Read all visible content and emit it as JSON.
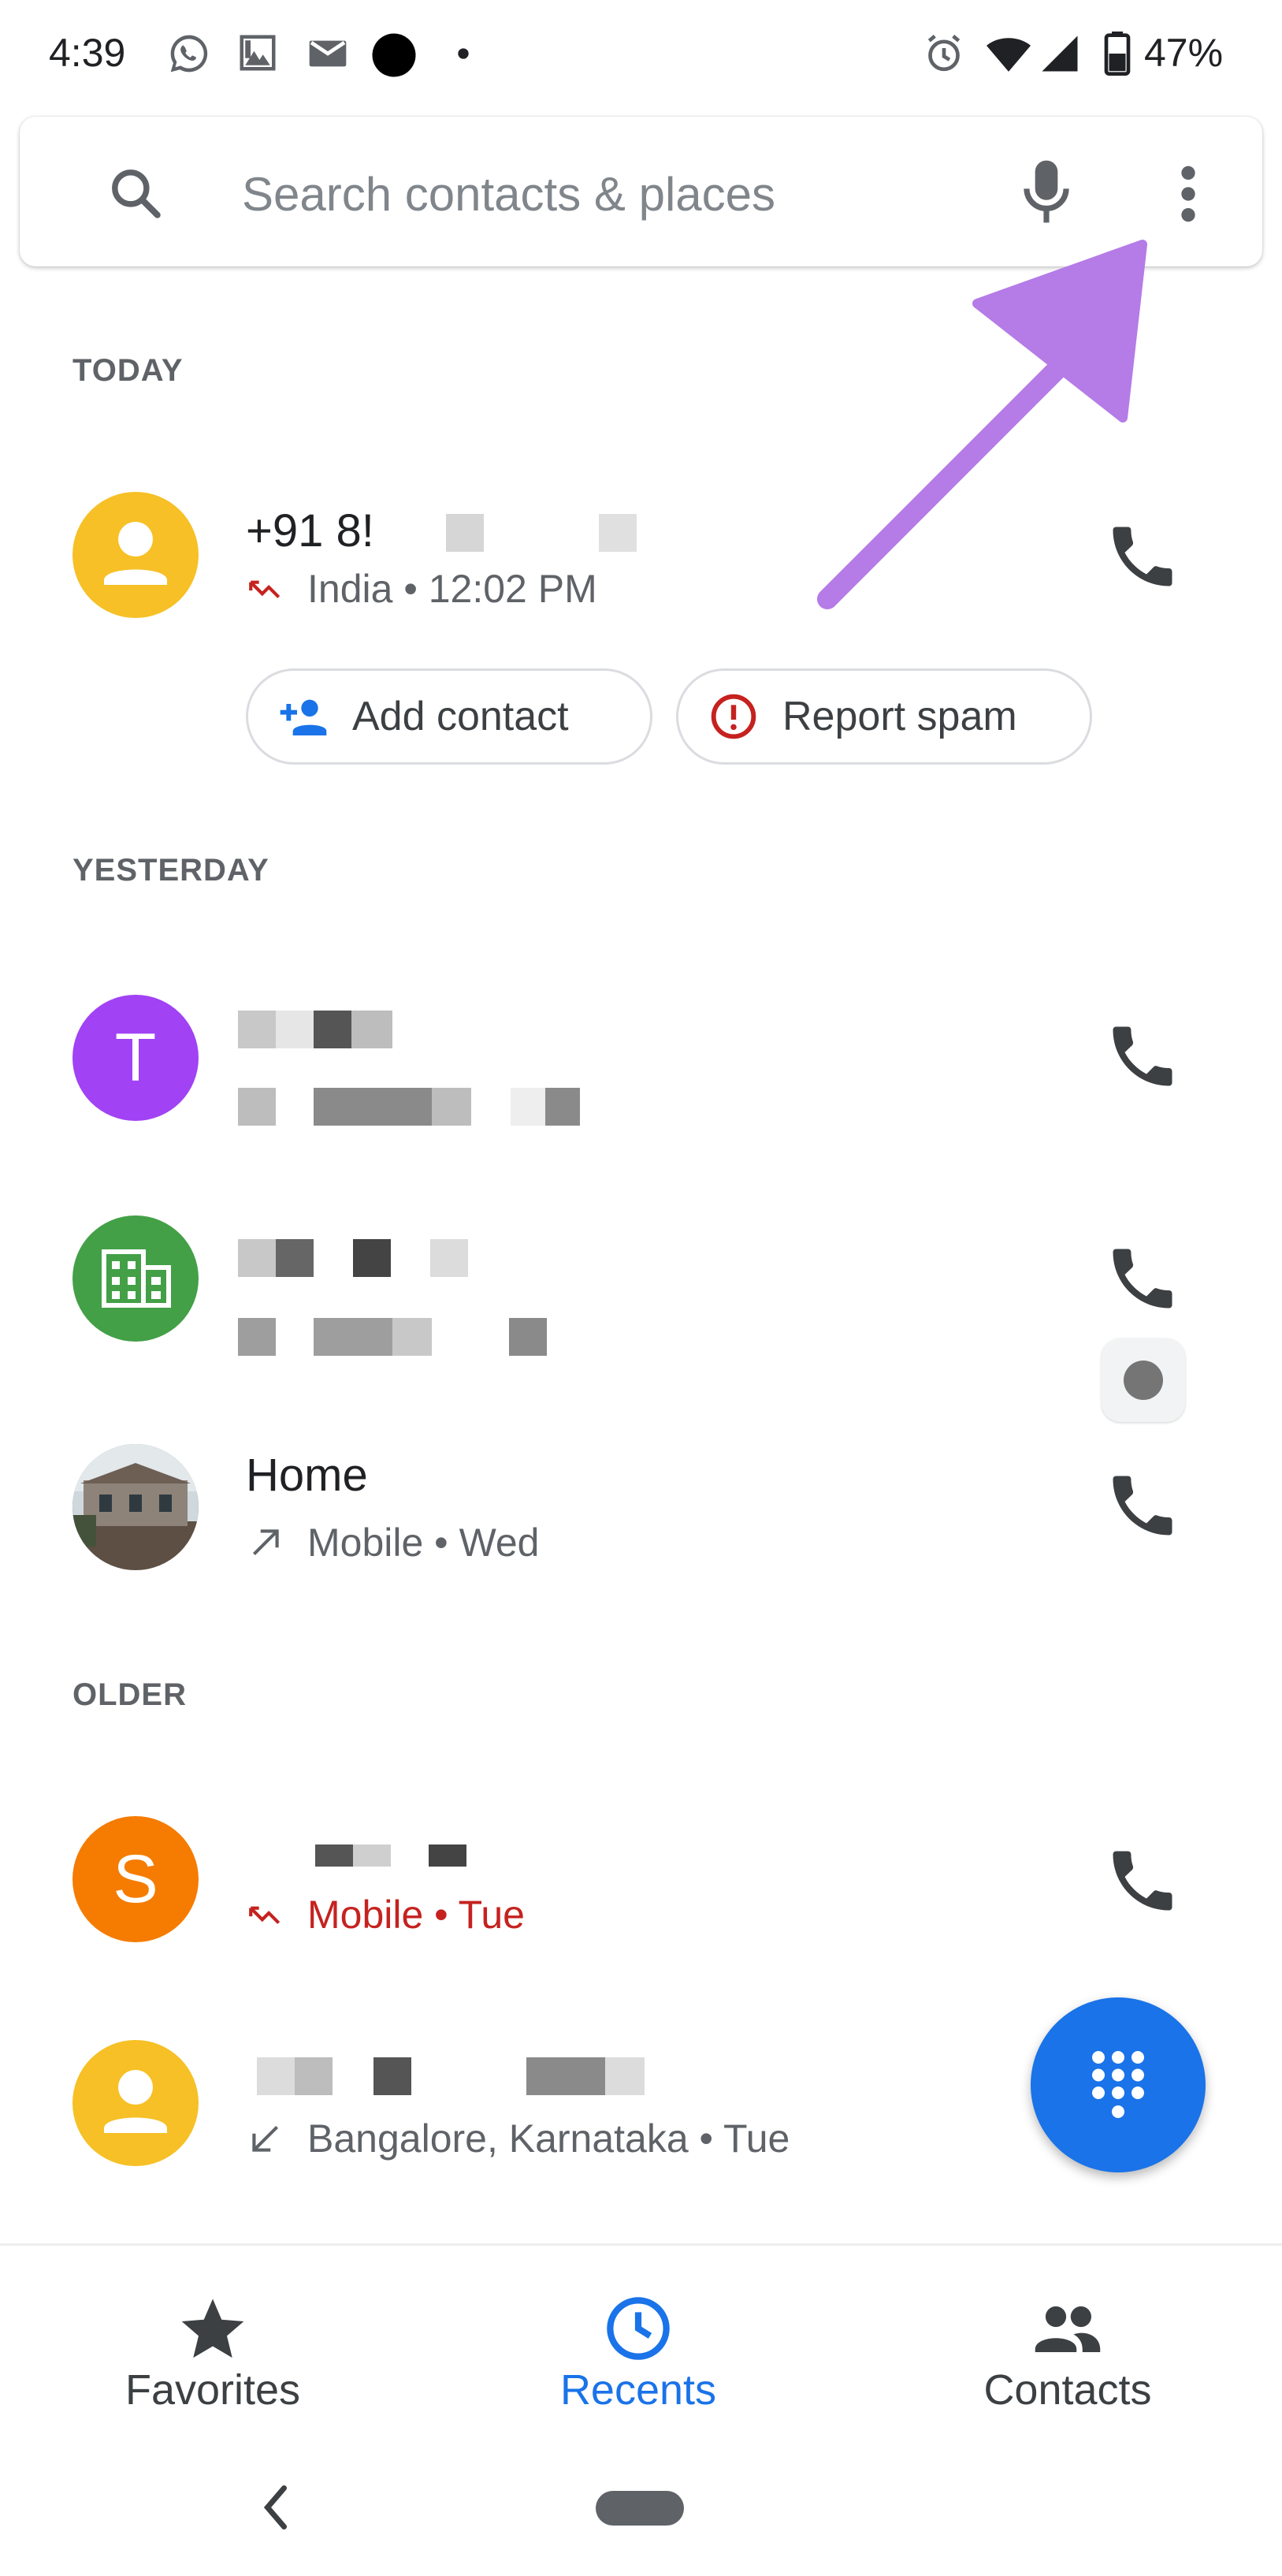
{
  "status_bar": {
    "time": "4:39",
    "battery": "47%",
    "icons": [
      "whatsapp-icon",
      "image-icon",
      "gmail-icon",
      "dot-icon",
      "alarm-icon",
      "wifi-icon",
      "signal-icon",
      "battery-icon"
    ]
  },
  "search": {
    "placeholder": "Search contacts & places",
    "icons": [
      "search-icon",
      "mic-icon",
      "more-vert-icon"
    ]
  },
  "annotation": {
    "color": "#b57be6"
  },
  "sections": {
    "today": "TODAY",
    "yesterday": "YESTERDAY",
    "older": "OLDER"
  },
  "calls": {
    "today_1": {
      "number": "+91 8!",
      "subtitle": "India • 12:02 PM",
      "call_type": "missed",
      "avatar": "person"
    },
    "yesterday_1": {
      "letter": "T",
      "avatar_color": "#a142f4"
    },
    "yesterday_2": {
      "avatar": "business",
      "avatar_color": "#43a047"
    },
    "yesterday_3": {
      "name": "Home",
      "subtitle": "Mobile • Wed",
      "call_type": "outgoing",
      "avatar": "photo"
    },
    "older_1": {
      "letter": "S",
      "subtitle": "Mobile • Tue",
      "call_type": "missed",
      "avatar_color": "#f57c00"
    },
    "older_2": {
      "subtitle": "Bangalore, Karnataka • Tue",
      "call_type": "incoming",
      "avatar": "person"
    }
  },
  "chips": {
    "add_contact": "Add contact",
    "report_spam": "Report spam"
  },
  "colors": {
    "accent": "#1a73e8",
    "missed": "#c5221f",
    "person_avatar": "#f6c026"
  },
  "bottom_nav": {
    "favorites": "Favorites",
    "recents": "Recents",
    "contacts": "Contacts",
    "active": "recents"
  }
}
